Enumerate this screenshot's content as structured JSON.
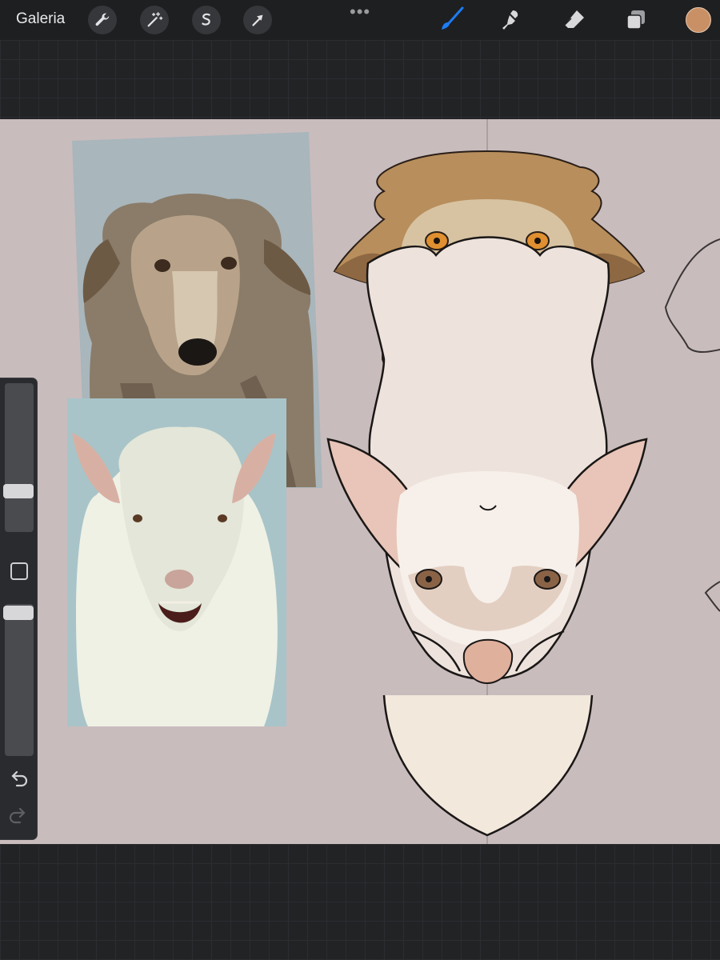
{
  "topbar": {
    "gallery_label": "Galeria",
    "left_tools": [
      "wrench-icon",
      "magic-wand-icon",
      "selection-icon",
      "transform-arrow-icon"
    ],
    "right_tools": [
      "brush-icon",
      "smudge-icon",
      "eraser-icon",
      "layers-icon"
    ],
    "active_tool": "brush",
    "current_color": "#c99066"
  },
  "canvas": {
    "background": "#c9bcbd",
    "reference_photos": [
      "wolf-photo",
      "sheep-photo"
    ],
    "drawings": [
      "wolf-head-drawing",
      "sheep-head-drawing",
      "partial-sketch-right"
    ]
  },
  "sidebar": {
    "brush_size_level": 0.3,
    "opacity_level": 0.0,
    "icons": [
      "modify-square-icon",
      "undo-icon",
      "redo-icon"
    ]
  }
}
